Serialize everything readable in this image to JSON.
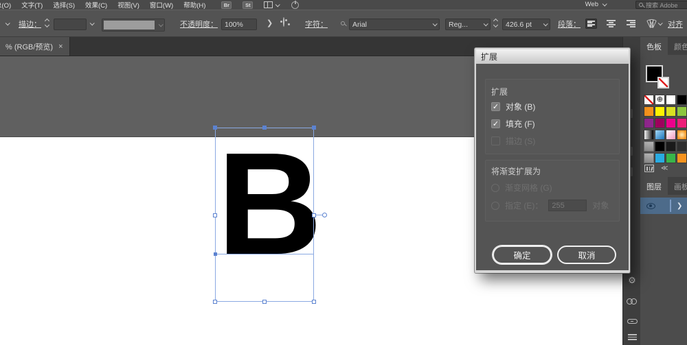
{
  "menu_bar": {
    "items": [
      "象(O)",
      "文字(T)",
      "选择(S)",
      "效果(C)",
      "视图(V)",
      "窗口(W)",
      "帮助(H)"
    ],
    "bridge_badge": "Br",
    "stock_badge": "St",
    "workspace_value": "Web",
    "search_placeholder": "搜索 Adobe",
    "icons": [
      "workspace-switcher-icon",
      "gpu-power-icon",
      "search-icon"
    ]
  },
  "control_bar": {
    "stroke_label": "描边：",
    "opacity_label": "不透明度：",
    "opacity_value": "100%",
    "opacity_flyout": "❯",
    "character_label": "字符：",
    "font_name": "Arial",
    "font_style": "Reg...",
    "font_size": "426.6 pt",
    "paragraph_label": "段落：",
    "align_label": "对齐",
    "icons": [
      "stroke-weight-stepper",
      "variable-width-profile",
      "recolor-artwork-icon",
      "font-search-icon",
      "align-left-icon",
      "align-center-icon",
      "align-right-icon",
      "brush-library-icon"
    ]
  },
  "document_tab": {
    "title": "% (RGB/预览)",
    "close_label": "×"
  },
  "canvas": {
    "letter": "B",
    "selection_color": "#8aa9e2"
  },
  "dialog": {
    "title": "扩展",
    "expand_group_label": "扩展",
    "checkbox_object": "对象 (B)",
    "checkbox_fill": "填充 (F)",
    "checkbox_stroke": "描边 (S)",
    "checkbox_object_checked": "true",
    "checkbox_fill_checked": "true",
    "checkbox_stroke_checked": "false",
    "gradient_group_label": "将渐变扩展为",
    "radio_mesh": "渐变网格 (G)",
    "radio_specify": "指定 (E)：",
    "specify_value": "255",
    "specify_suffix": "对象",
    "ok_label": "确定",
    "cancel_label": "取消",
    "check_glyph": "✓"
  },
  "right_panel": {
    "swatches_tab": "色板",
    "color_tab": "颜色",
    "layers_tab": "图层",
    "artboards_tab": "画板",
    "fill_color": "#000000",
    "stroke_style": "none",
    "registration_glyph": "⊕",
    "swatch_rows": [
      [
        "none",
        "registration",
        "#FFFFFF",
        "#000000",
        "#ED1C24"
      ],
      [
        "#F7941D",
        "#FFF200",
        "#D9E021",
        "#8DC63F",
        "#00A651"
      ],
      [
        "#92278F",
        "#9E005D",
        "#EC008C",
        "#ED1E79",
        "#C1272D"
      ],
      [
        "grad-bw",
        "grad-blue",
        "grad-pink",
        "grad-orange",
        "#E8E8E8"
      ],
      [
        "folder",
        "#000000",
        "#1A1A1A",
        "#2E2E2E",
        "#3F3F3F"
      ],
      [
        "folder",
        "#29ABE2",
        "#39B54A",
        "#F7931E",
        "#ED1C24"
      ]
    ],
    "layer_row": {
      "visible": true,
      "expand_glyph": "❯"
    }
  },
  "dock": {
    "icons": [
      "gear-icon",
      "creative-cloud-icon",
      "link-icon",
      "menu-icon"
    ],
    "gear_glyph": "⚙"
  }
}
